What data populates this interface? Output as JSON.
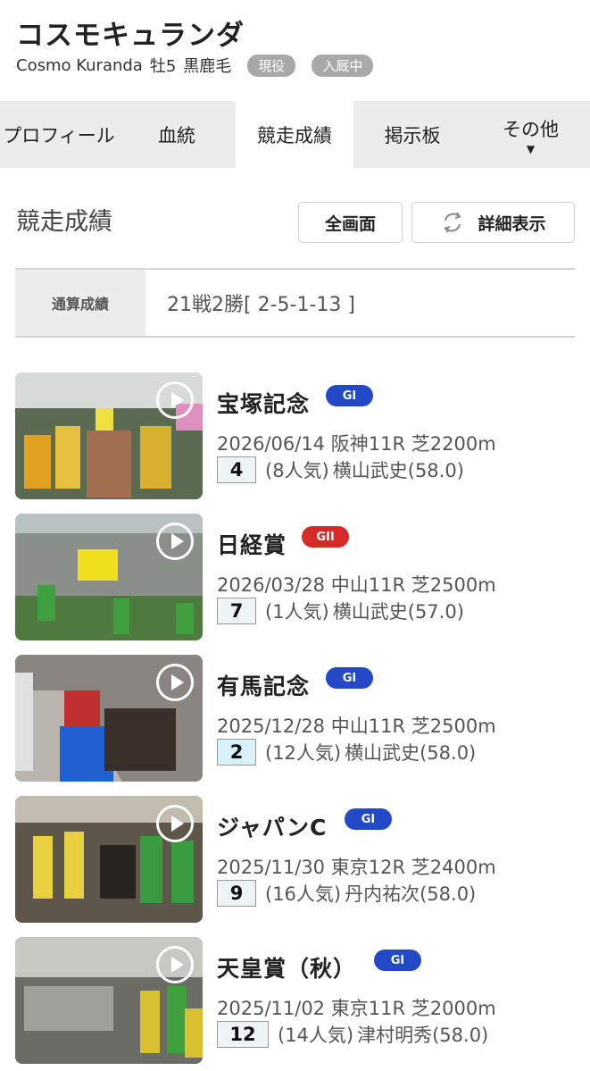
{
  "horse": {
    "name": "コスモキュランダ",
    "romaji": "Cosmo Kuranda",
    "sex_age": "牡5",
    "color": "黒鹿毛",
    "badges": [
      "現役",
      "入厩中"
    ]
  },
  "tabs": [
    {
      "label": "プロフィール",
      "active": false
    },
    {
      "label": "血統",
      "active": false
    },
    {
      "label": "競走成績",
      "active": true
    },
    {
      "label": "掲示板",
      "active": false
    },
    {
      "label": "その他",
      "active": false,
      "caret": "▼"
    }
  ],
  "section": {
    "title": "競走成績",
    "fullscreen_label": "全画面",
    "detail_label": "詳細表示"
  },
  "summary": {
    "label": "通算成績",
    "value": "21戦2勝[ 2-5-1-13 ]"
  },
  "colors": {
    "g1": "#2449c6",
    "g2": "#d42a2a",
    "tab_bg": "#ececec"
  },
  "races": [
    {
      "name": "宝塚記念",
      "grade": "GI",
      "grade_color": "g1",
      "date": "2026/06/14",
      "venue": "阪神11R",
      "course": "芝2200m",
      "rank": "4",
      "popularity": "(8人気)",
      "jockey": "横山武史(58.0)",
      "weight": "",
      "thumb_icon": "video-thumbnail"
    },
    {
      "name": "日経賞",
      "grade": "GII",
      "grade_color": "g2",
      "date": "2026/03/28",
      "venue": "中山11R",
      "course": "芝2500m",
      "rank": "7",
      "popularity": "(1人気)",
      "jockey": "横山武史(57.0)",
      "thumb_icon": "video-thumbnail"
    },
    {
      "name": "有馬記念",
      "grade": "GI",
      "grade_color": "g1",
      "date": "2025/12/28",
      "venue": "中山11R",
      "course": "芝2500m",
      "rank": "2",
      "popularity": "(12人気)",
      "jockey": "横山武史(58.0)",
      "thumb_icon": "video-thumbnail"
    },
    {
      "name": "ジャパンC",
      "grade": "GI",
      "grade_color": "g1",
      "date": "2025/11/30",
      "venue": "東京12R",
      "course": "芝2400m",
      "rank": "9",
      "popularity": "(16人気)",
      "jockey": "丹内祐次(58.0)",
      "thumb_icon": "video-thumbnail"
    },
    {
      "name": "天皇賞（秋）",
      "grade": "GI",
      "grade_color": "g1",
      "date": "2025/11/02",
      "venue": "東京11R",
      "course": "芝2000m",
      "rank": "12",
      "popularity": "(14人気)",
      "jockey": "津村明秀(58.0)",
      "thumb_icon": "video-thumbnail"
    }
  ]
}
